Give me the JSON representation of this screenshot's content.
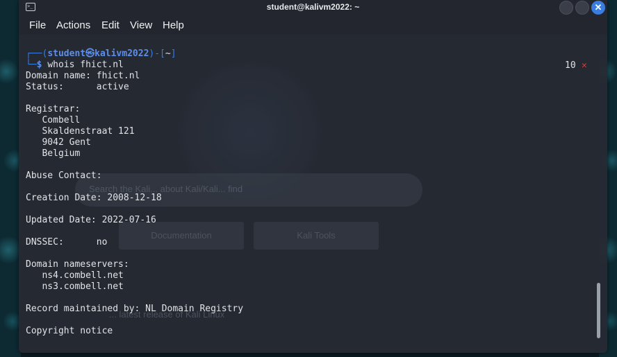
{
  "window": {
    "title": "student@kalivm2022: ~",
    "app_icon": ">_",
    "close_glyph": "✕"
  },
  "menu": [
    "File",
    "Actions",
    "Edit",
    "View",
    "Help"
  ],
  "background_splash": {
    "search_placeholder": "Search the Kali... about Kali/Kali... find",
    "buttons": [
      "Documentation",
      "Kali Tools"
    ],
    "footer": "... latest release of Kali Linux"
  },
  "prompt": {
    "top_prefix": "┌──(",
    "user": "student",
    "at": "㉿",
    "host": "kalivm2022",
    "mid": ")-[",
    "path": "~",
    "end": "]",
    "bottom_prefix": "└─",
    "dollar": "$",
    "command": "whois fhict.nl"
  },
  "status": {
    "count": "10",
    "error_glyph": "✕"
  },
  "output_lines": [
    "Domain name: fhict.nl",
    "Status:      active",
    "",
    "Registrar:",
    "   Combell",
    "   Skaldenstraat 121",
    "   9042 Gent",
    "   Belgium",
    "",
    "Abuse Contact:",
    "",
    "Creation Date: 2008-12-18",
    "",
    "Updated Date: 2022-07-16",
    "",
    "DNSSEC:      no",
    "",
    "Domain nameservers:",
    "   ns4.combell.net",
    "   ns3.combell.net",
    "",
    "Record maintained by: NL Domain Registry",
    "",
    "Copyright notice"
  ],
  "colors": {
    "accent": "#3a7de0",
    "terminal_bg": "#262a33",
    "error": "#e03a3a"
  }
}
